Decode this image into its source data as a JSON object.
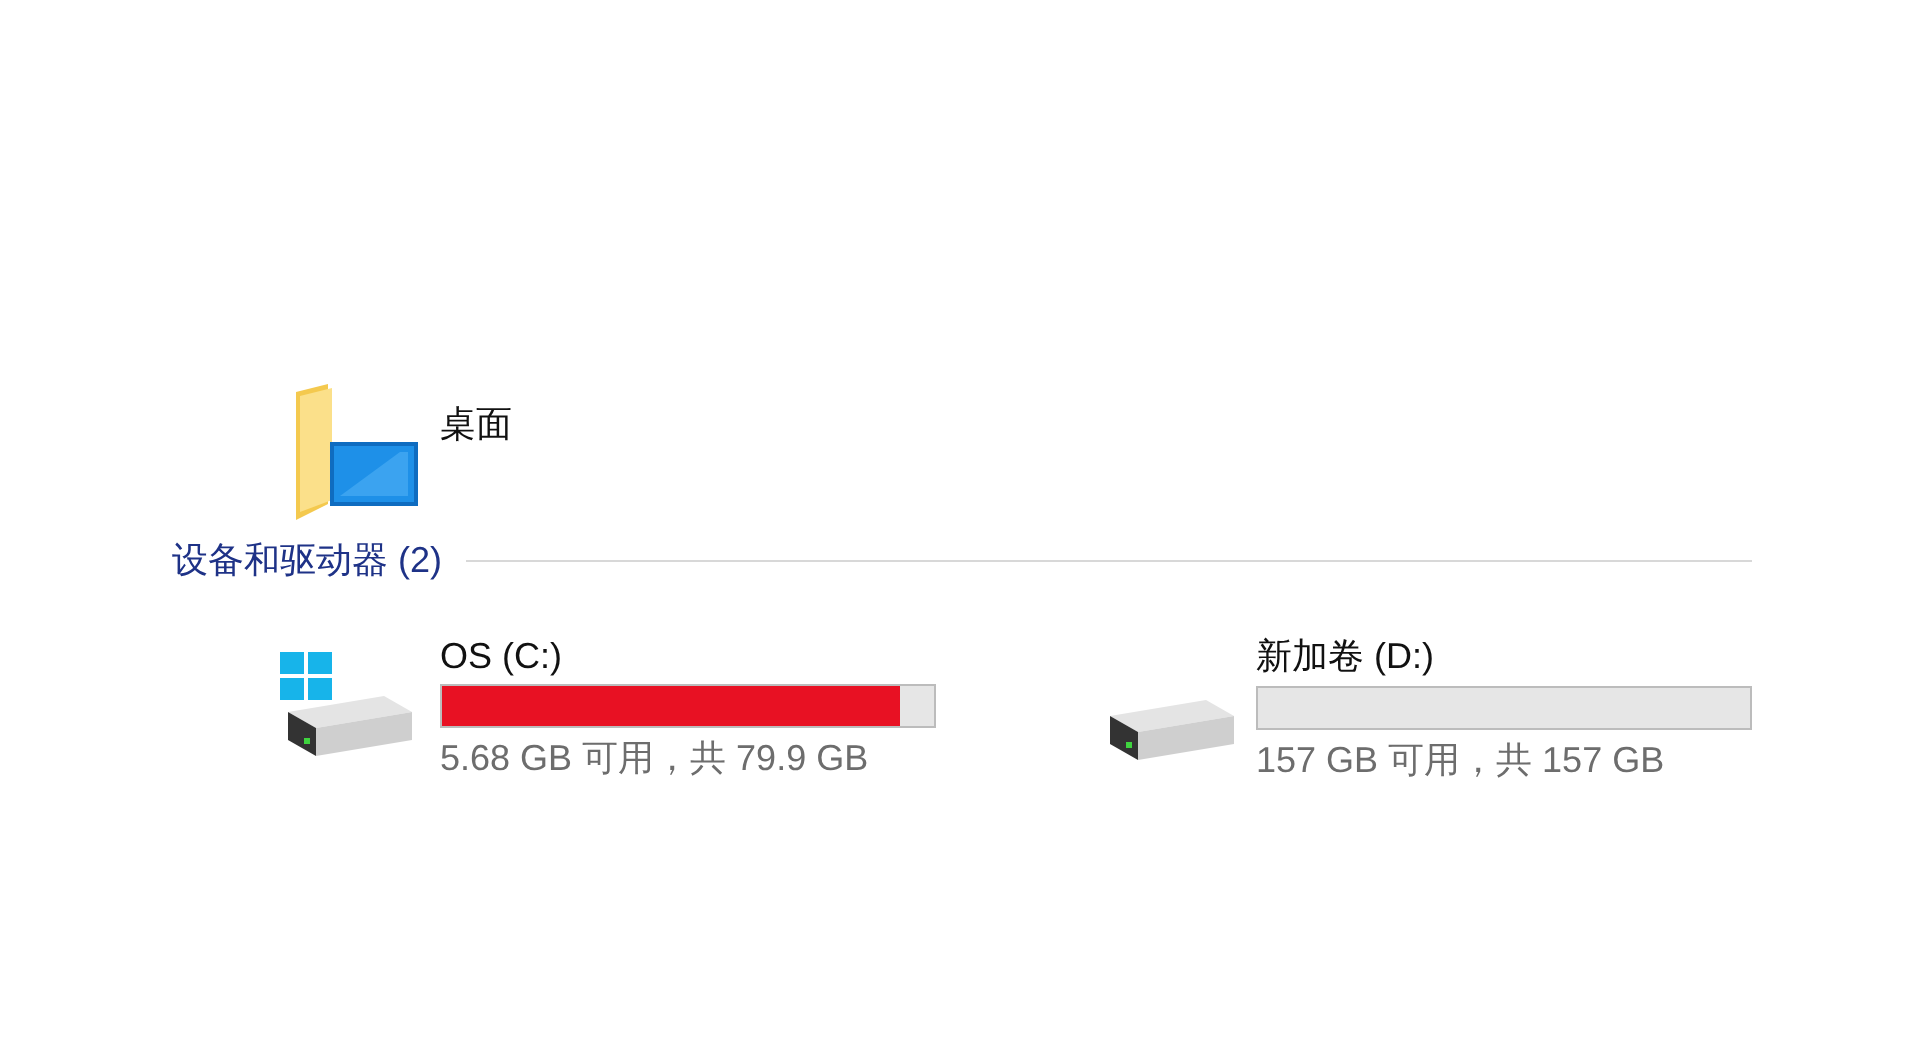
{
  "folders": [
    {
      "name": "桌面",
      "kind": "desktop"
    }
  ],
  "section": {
    "title": "设备和驱动器 (2)"
  },
  "drives": [
    {
      "name": "OS (C:)",
      "kind": "system",
      "level": 0.93,
      "usage": "5.68 GB 可用，共 79.9 GB"
    },
    {
      "name": "新加卷 (D:)",
      "kind": "data",
      "level": 0,
      "usage": "157 GB 可用，共 157 GB"
    }
  ]
}
